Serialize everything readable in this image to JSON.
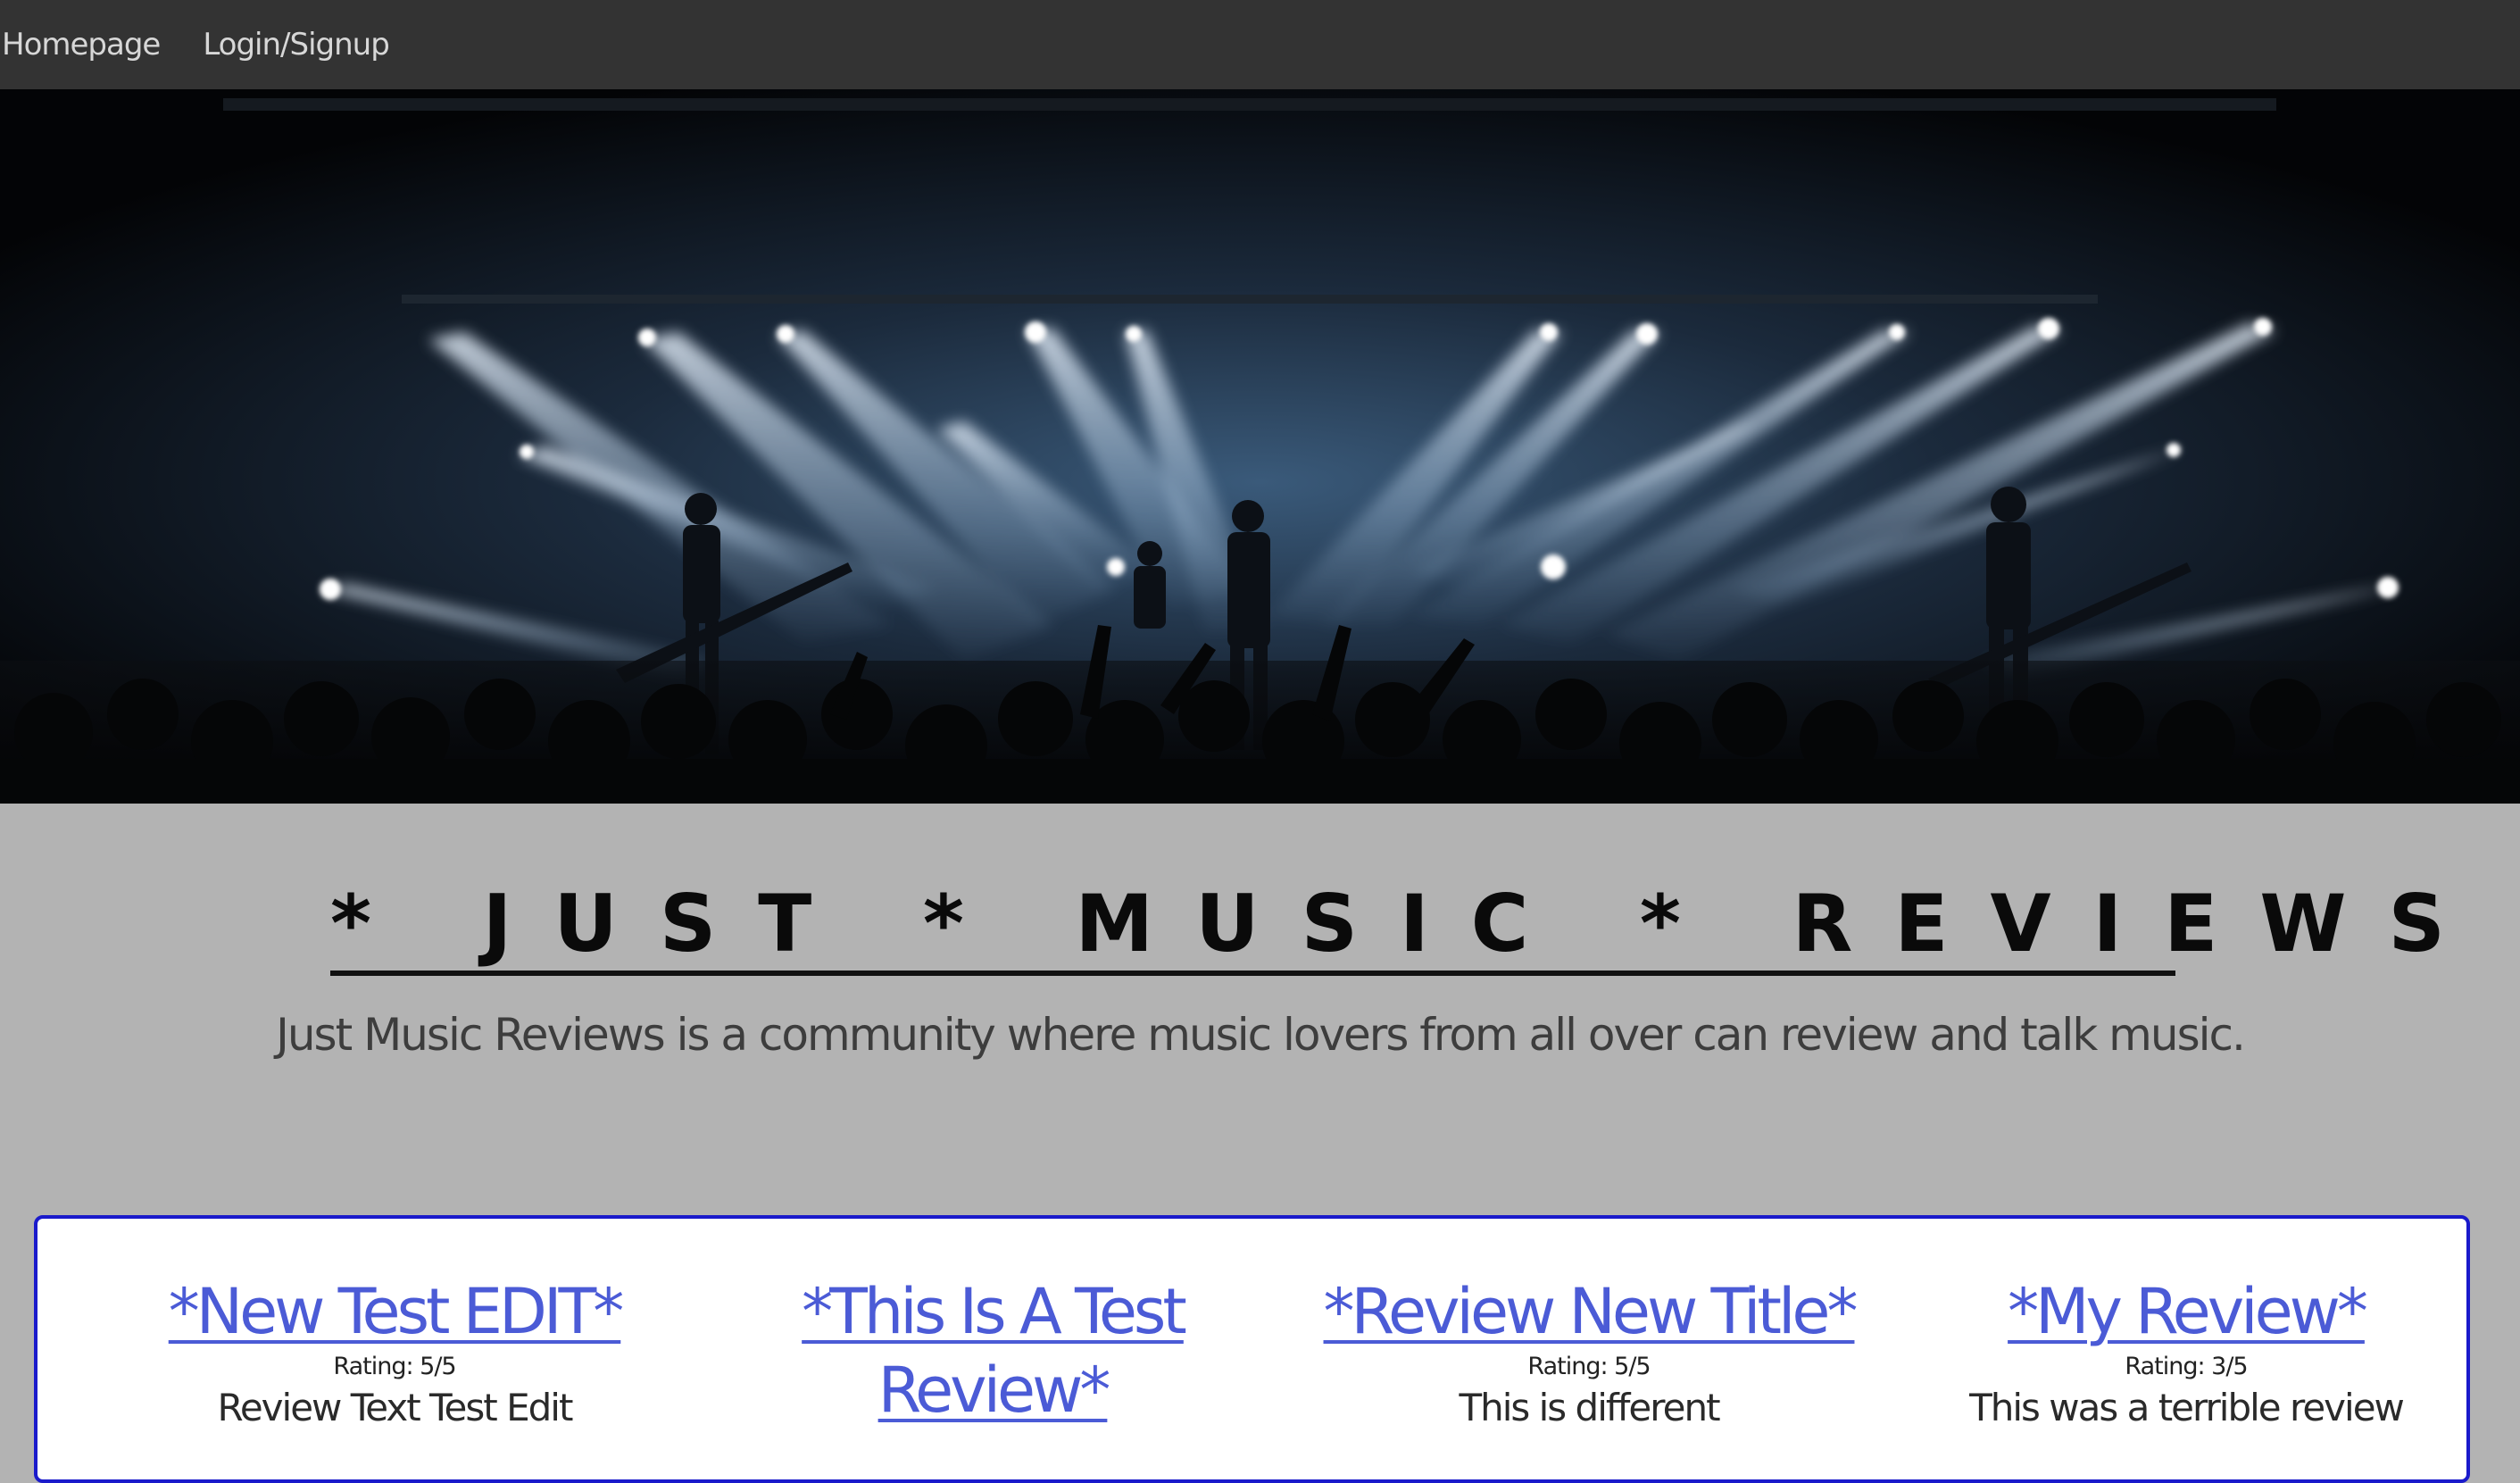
{
  "nav": {
    "items": [
      {
        "label": "Homepage"
      },
      {
        "label": "Login/Signup"
      }
    ]
  },
  "hero": {
    "image_description_icon": "concert-stage-photo"
  },
  "site": {
    "title": "* JUST * MUSIC * REVIEWS *",
    "tagline": "Just Music Reviews is a community where music lovers from all over can review and talk music."
  },
  "reviews": [
    {
      "title": "*New Test EDIT*",
      "rating": "Rating: 5/5",
      "text": "Review Text Test Edit"
    },
    {
      "title": "*This Is A Test Review*",
      "rating": "",
      "text": ""
    },
    {
      "title": "*Review New Title*",
      "rating": "Rating: 5/5",
      "text": "This is different"
    },
    {
      "title": "*My Review*",
      "rating": "Rating: 3/5",
      "text": "This was a terrible review"
    }
  ],
  "colors": {
    "nav_bg": "#333333",
    "page_bg": "#b3b3b3",
    "link": "#4b5bd6",
    "card_border": "#1a1acb"
  }
}
